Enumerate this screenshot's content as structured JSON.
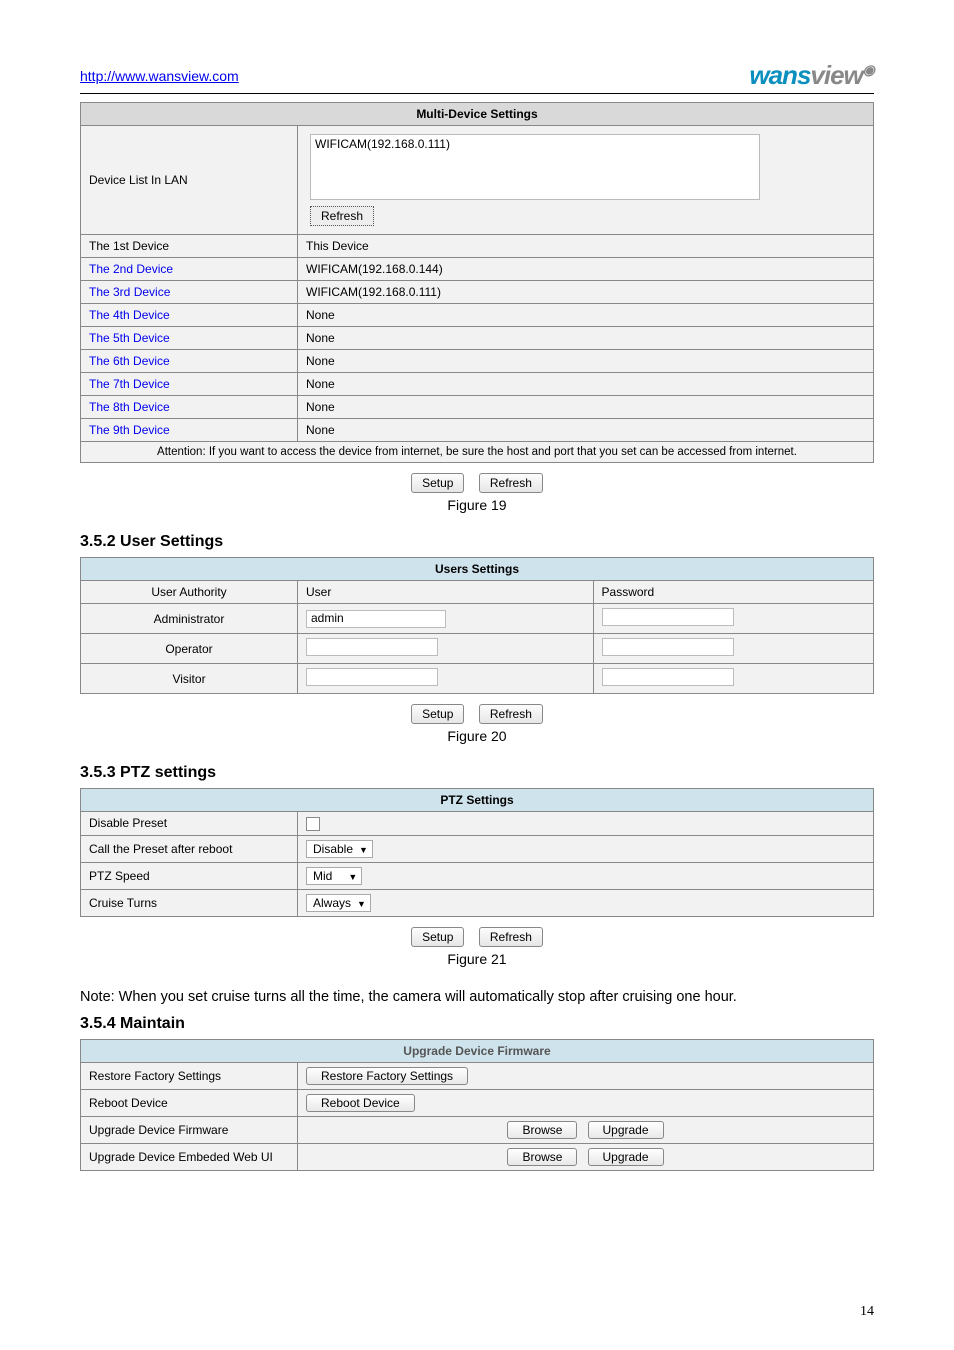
{
  "header": {
    "link": "http://www.wansview.com",
    "logo_part1": "wans",
    "logo_part2": "view"
  },
  "multi_device": {
    "title": "Multi-Device Settings",
    "list_label": "Device List In LAN",
    "list_item": "WIFICAM(192.168.0.111)",
    "refresh_btn": "Refresh",
    "rows": [
      {
        "name": "The 1st Device",
        "value": "This Device",
        "link": false
      },
      {
        "name": "The 2nd Device",
        "value": "WIFICAM(192.168.0.144)",
        "link": true
      },
      {
        "name": "The 3rd Device",
        "value": "WIFICAM(192.168.0.111)",
        "link": true
      },
      {
        "name": "The 4th Device",
        "value": "None",
        "link": true
      },
      {
        "name": "The 5th Device",
        "value": "None",
        "link": true
      },
      {
        "name": "The 6th Device",
        "value": "None",
        "link": true
      },
      {
        "name": "The 7th Device",
        "value": "None",
        "link": true
      },
      {
        "name": "The 8th Device",
        "value": "None",
        "link": true
      },
      {
        "name": "The 9th Device",
        "value": "None",
        "link": true
      }
    ],
    "attention": "Attention: If you want to access the device from internet, be sure the host and port that you set can be accessed from internet."
  },
  "common": {
    "setup_btn": "Setup",
    "refresh_btn": "Refresh"
  },
  "figs": {
    "fig19": "Figure 19",
    "fig20": "Figure 20",
    "fig21": "Figure 21"
  },
  "sections": {
    "user_settings_h": "3.5.2  User Settings",
    "ptz_h": "3.5.3  PTZ settings",
    "maintain_h": "3.5.4  Maintain"
  },
  "users": {
    "title": "Users Settings",
    "h_authority": "User Authority",
    "h_user": "User",
    "h_password": "Password",
    "rows": [
      {
        "auth": "Administrator",
        "user": "admin"
      },
      {
        "auth": "Operator",
        "user": ""
      },
      {
        "auth": "Visitor",
        "user": ""
      }
    ]
  },
  "ptz": {
    "title": "PTZ Settings",
    "r1": "Disable Preset",
    "r2": "Call the Preset after reboot",
    "r2_val": "Disable",
    "r3": "PTZ Speed",
    "r3_val": "Mid",
    "r4": "Cruise Turns",
    "r4_val": "Always"
  },
  "ptz_note": "Note: When you set cruise turns all the time, the camera will automatically stop after cruising one hour.",
  "maintain": {
    "title": "Upgrade Device Firmware",
    "r1": "Restore Factory Settings",
    "r1_btn": "Restore Factory Settings",
    "r2": "Reboot Device",
    "r2_btn": "Reboot Device",
    "r3": "Upgrade Device Firmware",
    "r4": "Upgrade Device Embeded Web UI",
    "browse_btn": "Browse",
    "upgrade_btn": "Upgrade"
  },
  "page_num": "14"
}
